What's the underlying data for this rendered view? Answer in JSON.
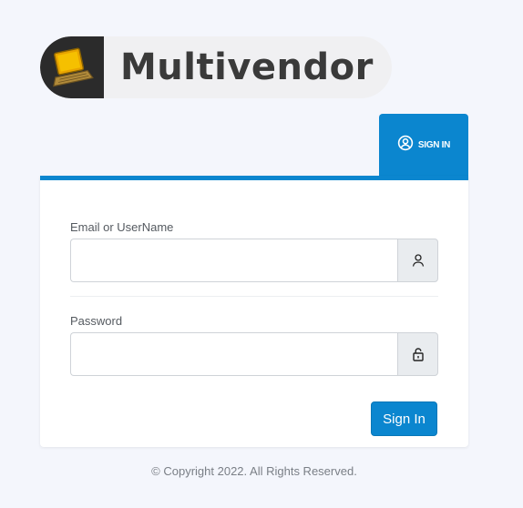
{
  "brand": {
    "name": "Multivendor",
    "logo_icon": "laptop-icon"
  },
  "tab": {
    "label": "SIGN IN",
    "icon": "user-circle-icon"
  },
  "form": {
    "username": {
      "label": "Email or UserName",
      "value": "",
      "icon": "user-icon"
    },
    "password": {
      "label": "Password",
      "value": "",
      "icon": "lock-icon"
    },
    "submit_label": "Sign In"
  },
  "footer": {
    "copyright": "© Copyright 2022. All Rights Reserved."
  },
  "colors": {
    "accent": "#0b86cf",
    "background": "#f4f6fc"
  }
}
